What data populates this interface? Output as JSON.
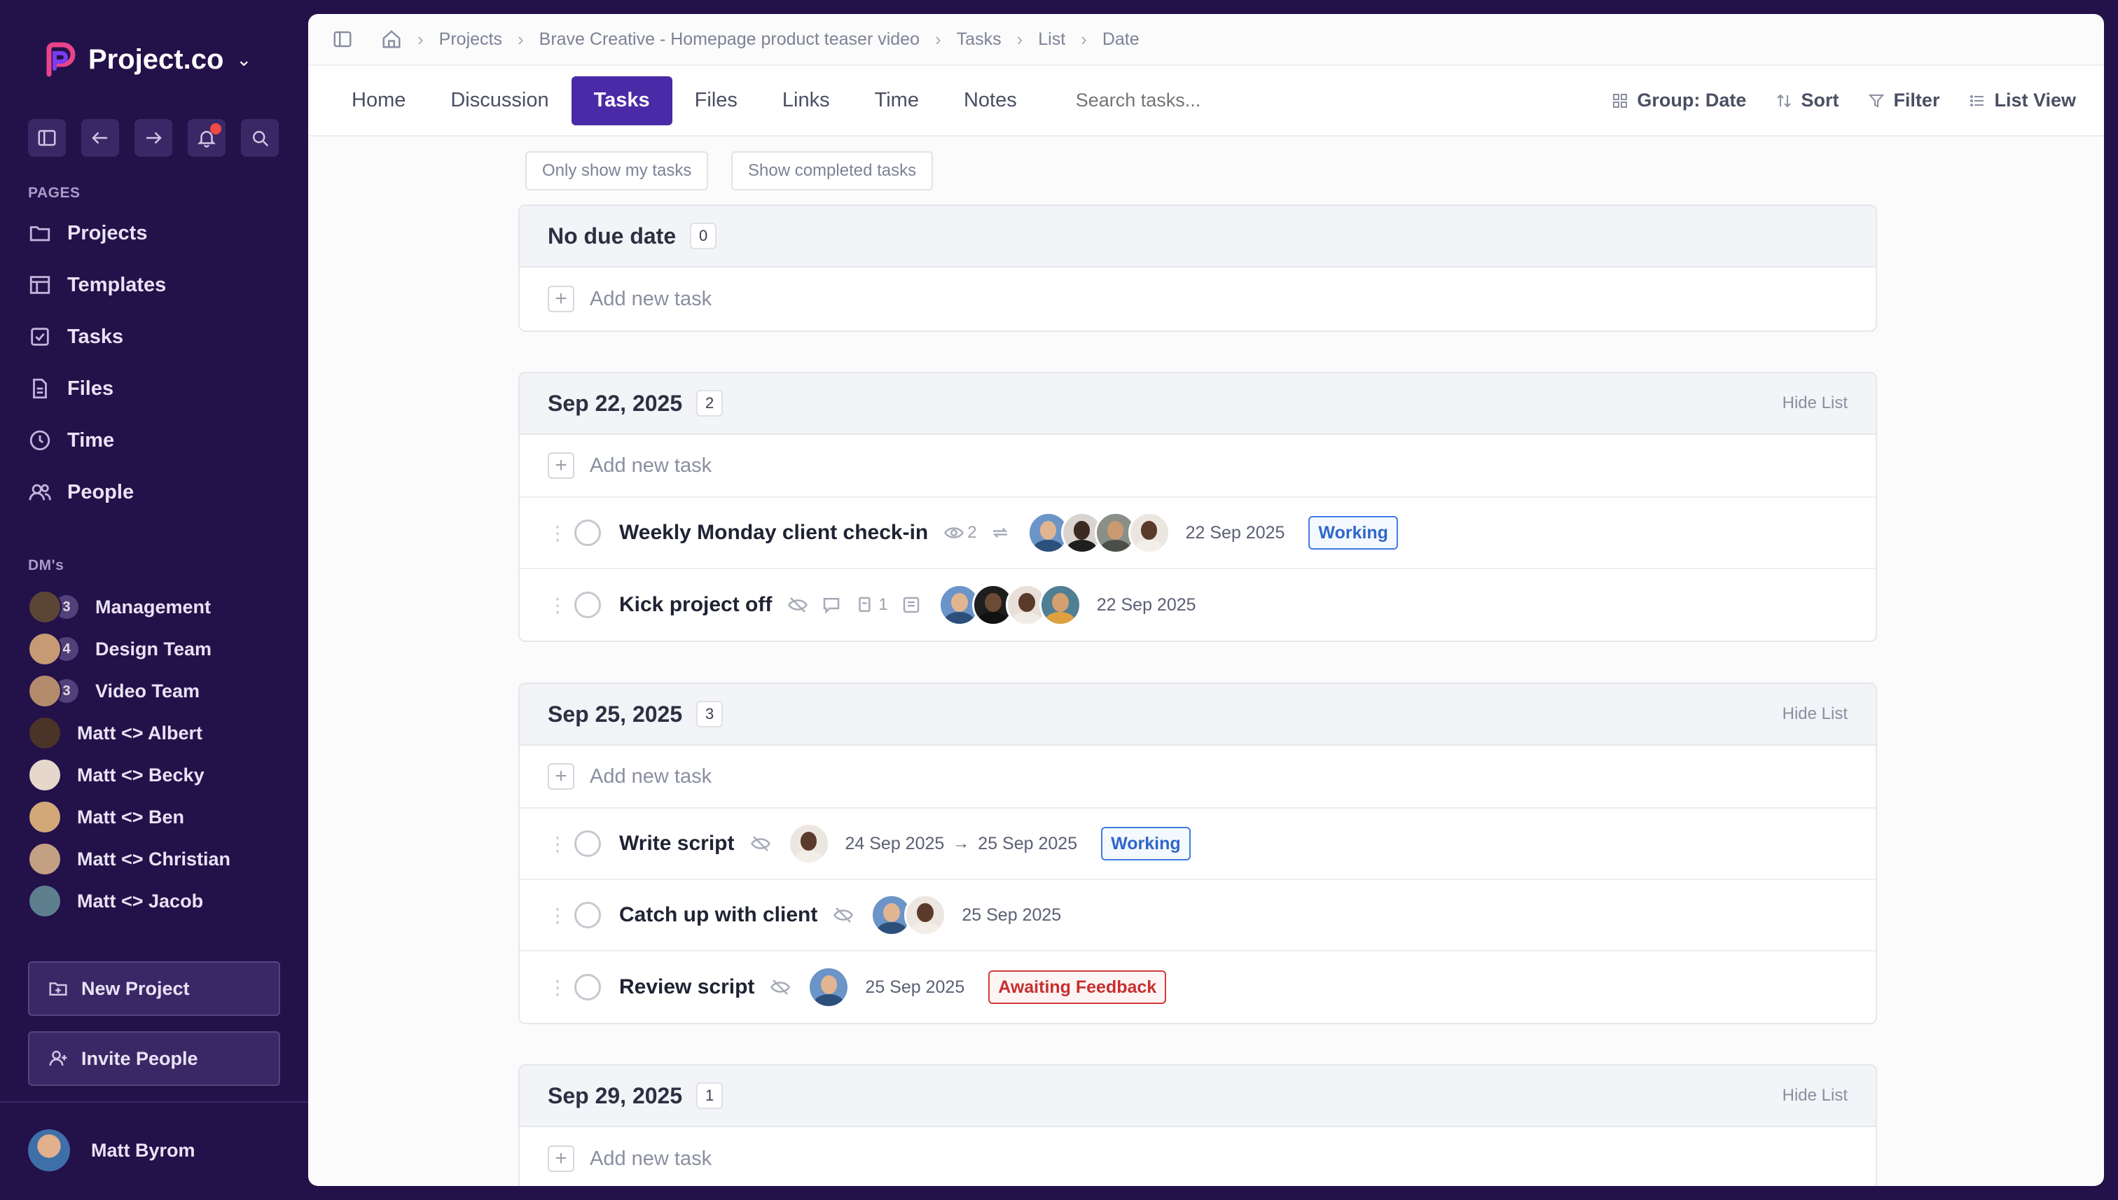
{
  "brand": {
    "name": "Project.co",
    "colors": {
      "logo_pink": "#e8448a",
      "logo_purple": "#7a3cf0"
    }
  },
  "sidebar": {
    "pages_label": "PAGES",
    "pages": [
      {
        "label": "Projects",
        "icon": "folder-icon"
      },
      {
        "label": "Templates",
        "icon": "template-icon"
      },
      {
        "label": "Tasks",
        "icon": "checkbox-icon"
      },
      {
        "label": "Files",
        "icon": "file-icon"
      },
      {
        "label": "Time",
        "icon": "clock-icon"
      },
      {
        "label": "People",
        "icon": "people-icon"
      }
    ],
    "dms_label": "DM's",
    "dms": [
      {
        "label": "Management",
        "count": "3"
      },
      {
        "label": "Design Team",
        "count": "4"
      },
      {
        "label": "Video Team",
        "count": "3"
      },
      {
        "label": "Matt <> Albert"
      },
      {
        "label": "Matt <> Becky"
      },
      {
        "label": "Matt <> Ben"
      },
      {
        "label": "Matt <> Christian"
      },
      {
        "label": "Matt <> Jacob"
      }
    ],
    "new_project": "New Project",
    "invite_people": "Invite People",
    "user_name": "Matt Byrom"
  },
  "breadcrumb": [
    "Projects",
    "Brave Creative - Homepage product teaser video",
    "Tasks",
    "List",
    "Date"
  ],
  "tabs": [
    "Home",
    "Discussion",
    "Tasks",
    "Files",
    "Links",
    "Time",
    "Notes"
  ],
  "active_tab": "Tasks",
  "search": {
    "placeholder": "Search tasks..."
  },
  "toolbar": {
    "group": "Group: Date",
    "sort": "Sort",
    "filter": "Filter",
    "view": "List View"
  },
  "filters": {
    "my_tasks": "Only show my tasks",
    "completed": "Show completed tasks"
  },
  "common": {
    "add_task": "Add new task",
    "hide_list": "Hide List"
  },
  "groups": [
    {
      "title": "No due date",
      "count": "0",
      "tasks": []
    },
    {
      "title": "Sep 22, 2025",
      "count": "2",
      "tasks": [
        {
          "title": "Weekly Monday client check-in",
          "watchers": "2",
          "date": "22 Sep 2025",
          "status": "Working"
        },
        {
          "title": "Kick project off",
          "files": "1",
          "date": "22 Sep 2025"
        }
      ]
    },
    {
      "title": "Sep 25, 2025",
      "count": "3",
      "tasks": [
        {
          "title": "Write script",
          "date_start": "24 Sep 2025",
          "date_end": "25 Sep 2025",
          "status": "Working"
        },
        {
          "title": "Catch up with client",
          "date": "25 Sep 2025"
        },
        {
          "title": "Review script",
          "date": "25 Sep 2025",
          "status": "Awaiting Feedback"
        }
      ]
    },
    {
      "title": "Sep 29, 2025",
      "count": "1",
      "tasks": []
    }
  ],
  "colors": {
    "sidebar_bg": "#23114a",
    "accent": "#4a2aa6",
    "working": "#2f67c8",
    "awaiting": "#c62f2f",
    "notification": "#ef4a45"
  }
}
